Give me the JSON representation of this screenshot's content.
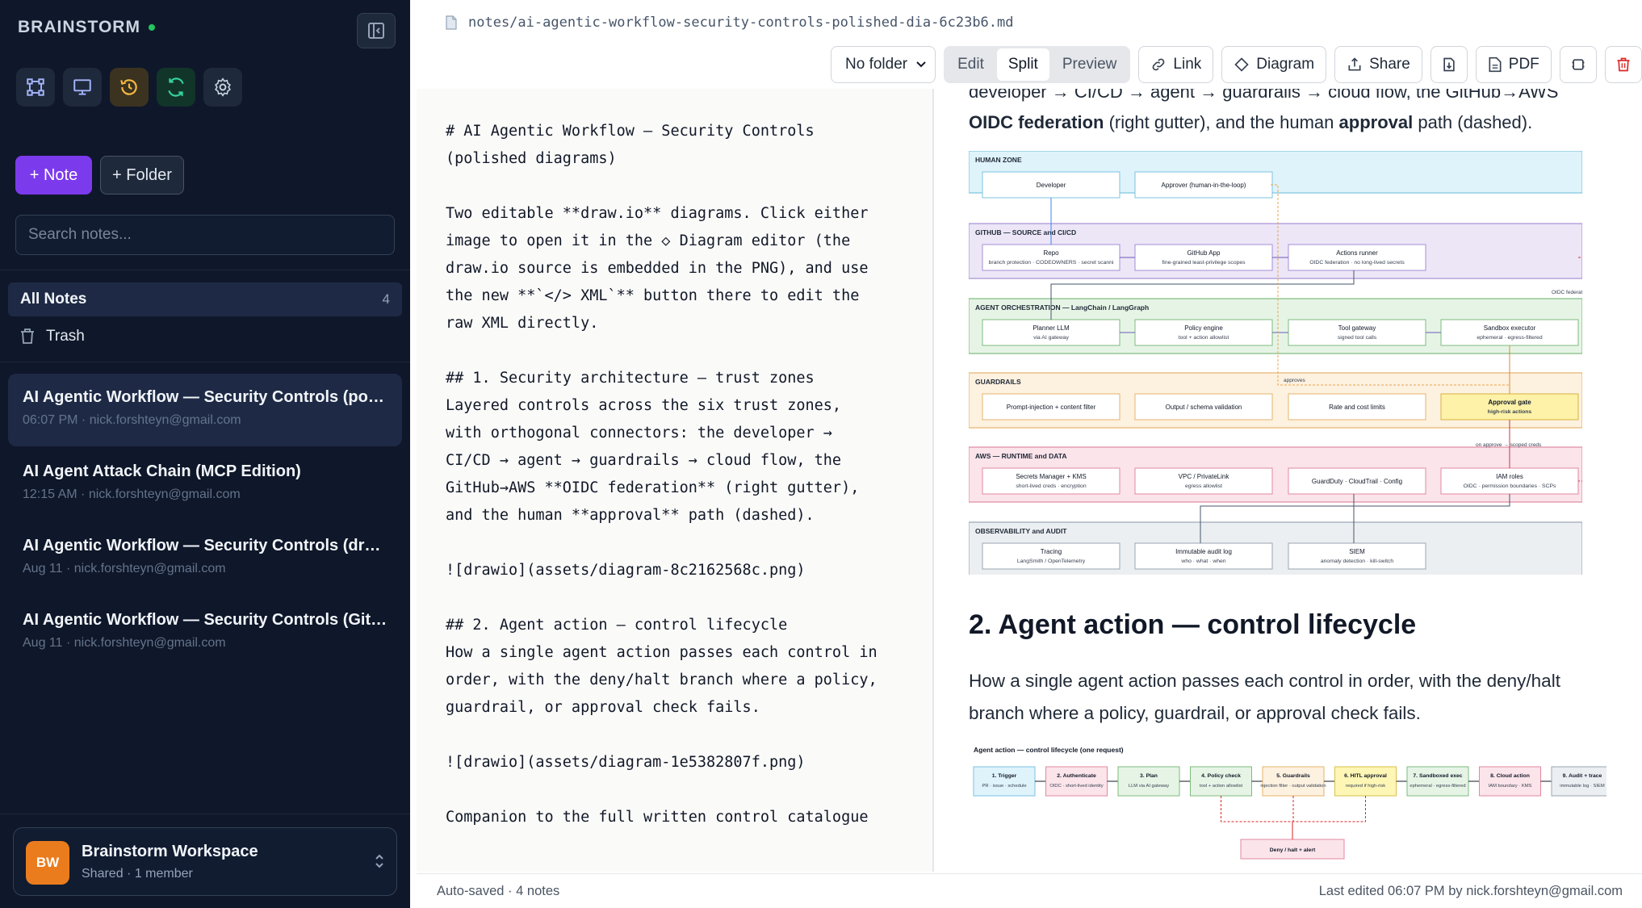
{
  "sidebar": {
    "brand": "BRAINSTORM",
    "new_note_label": "+ Note",
    "new_folder_label": "+ Folder",
    "search_placeholder": "Search notes...",
    "all_notes_label": "All Notes",
    "all_notes_count": "4",
    "trash_label": "Trash",
    "notes": [
      {
        "title": "AI Agentic Workflow — Security Controls (polished diagrams)",
        "meta": "06:07 PM · nick.forshteyn@gmail.com"
      },
      {
        "title": "AI Agent Attack Chain (MCP Edition)",
        "meta": "12:15 AM · nick.forshteyn@gmail.com"
      },
      {
        "title": "AI Agentic Workflow — Security Controls (draw.io)",
        "meta": "Aug 11 · nick.forshteyn@gmail.com"
      },
      {
        "title": "AI Agentic Workflow — Security Controls (GitHub)",
        "meta": "Aug 11 · nick.forshteyn@gmail.com"
      }
    ],
    "workspace": {
      "initials": "BW",
      "name": "Brainstorm Workspace",
      "sub": "Shared · 1 member"
    }
  },
  "header": {
    "file_path": "notes/ai-agentic-workflow-security-controls-polished-dia-6c23b6.md",
    "folder_select": "No folder",
    "modes": [
      "Edit",
      "Split",
      "Preview"
    ],
    "active_mode": "Split",
    "link_label": "Link",
    "diagram_label": "Diagram",
    "share_label": "Share",
    "pdf_label": "PDF"
  },
  "editor": {
    "source": "# AI Agentic Workflow — Security Controls\n(polished diagrams)\n\nTwo editable **draw.io** diagrams. Click either\nimage to open it in the ◇ Diagram editor (the\ndraw.io source is embedded in the PNG), and use\nthe new **`</> XML`** button there to edit the\nraw XML directly.\n\n## 1. Security architecture — trust zones\nLayered controls across the six trust zones,\nwith orthogonal connectors: the developer →\nCI/CD → agent → guardrails → cloud flow, the\nGitHub→AWS **OIDC federation** (right gutter),\nand the human **approval** path (dashed).\n\n![drawio](assets/diagram-8c2162568c.png)\n\n## 2. Agent action — control lifecycle\nHow a single agent action passes each control in\norder, with the deny/halt branch where a policy,\nguardrail, or approval check fails.\n\n![drawio](assets/diagram-1e5382807f.png)\n\nCompanion to the full written control catalogue"
  },
  "preview": {
    "intro_line1": "developer → CI/CD → agent → guardrails → cloud flow, the GitHub→AWS",
    "intro_bold1": "OIDC federation",
    "intro_mid": " (right gutter), and the human ",
    "intro_bold2": "approval",
    "intro_end": " path (dashed).",
    "section2_heading": "2. Agent action — control lifecycle",
    "section2_text": "How a single agent action passes each control in order, with the deny/halt branch where a policy, guardrail, or approval check fails.",
    "diagram1": {
      "zones": [
        {
          "title": "HUMAN ZONE",
          "fill": "#dff3fb",
          "stroke": "#7cc3e0",
          "boxes": [
            [
              "Developer",
              ""
            ],
            [
              "Approver (human-in-the-loop)",
              ""
            ]
          ]
        },
        {
          "title": "GITHUB — SOURCE and CI/CD",
          "fill": "#ece6f7",
          "stroke": "#a58fd6",
          "boxes": [
            [
              "Repo",
              "branch protection · CODEOWNERS · secret scanning · CodeQL"
            ],
            [
              "GitHub App",
              "fine-grained least-privilege scopes"
            ],
            [
              "Actions runner",
              "OIDC federation · no long-lived secrets"
            ]
          ]
        },
        {
          "title": "AGENT ORCHESTRATION — LangChain / LangGraph",
          "fill": "#e6f4e6",
          "stroke": "#7dbb7d",
          "boxes": [
            [
              "Planner LLM",
              "via AI gateway"
            ],
            [
              "Policy engine",
              "tool + action allowlist"
            ],
            [
              "Tool gateway",
              "signed tool calls"
            ],
            [
              "Sandbox executor",
              "ephemeral · egress-filtered"
            ]
          ]
        },
        {
          "title": "GUARDRAILS",
          "fill": "#fdf1e0",
          "stroke": "#e6b46b",
          "boxes": [
            [
              "Prompt-injection + content filter",
              ""
            ],
            [
              "Output / schema validation",
              ""
            ],
            [
              "Rate and cost limits",
              ""
            ],
            [
              "Approval gate",
              "high-risk actions"
            ]
          ]
        },
        {
          "title": "AWS — RUNTIME and DATA",
          "fill": "#fbe4ea",
          "stroke": "#e08aa0",
          "boxes": [
            [
              "Secrets Manager + KMS",
              "short-lived creds · encryption"
            ],
            [
              "VPC / PrivateLink",
              "egress allowlist"
            ],
            [
              "GuardDuty · CloudTrail · Config",
              ""
            ],
            [
              "IAM roles",
              "OIDC · permission boundaries · SCPs"
            ]
          ]
        },
        {
          "title": "OBSERVABILITY and AUDIT",
          "fill": "#eceff2",
          "stroke": "#9aa6b2",
          "boxes": [
            [
              "Tracing",
              "LangSmith / OpenTelemetry"
            ],
            [
              "Immutable audit log",
              "who · what · when"
            ],
            [
              "SIEM",
              "anomaly detection · kill-switch"
            ]
          ]
        }
      ],
      "edge_labels": [
        "approves",
        "on approve → scoped creds",
        "OIDC federation"
      ]
    },
    "diagram2": {
      "title": "Agent action — control lifecycle (one request)",
      "steps": [
        {
          "t": "1. Trigger",
          "s": "PR · issue · schedule",
          "fill": "#dff3fb",
          "stroke": "#7cc3e0"
        },
        {
          "t": "2. Authenticate",
          "s": "OIDC · short-lived identity",
          "fill": "#fbe4ea",
          "stroke": "#e08aa0"
        },
        {
          "t": "3. Plan",
          "s": "LLM via AI gateway",
          "fill": "#e6f4e6",
          "stroke": "#7dbb7d"
        },
        {
          "t": "4. Policy check",
          "s": "tool + action allowlist",
          "fill": "#e6f4e6",
          "stroke": "#7dbb7d"
        },
        {
          "t": "5. Guardrails",
          "s": "injection filter · output validation",
          "fill": "#fdf1e0",
          "stroke": "#e6b46b"
        },
        {
          "t": "6. HITL approval",
          "s": "required if high-risk",
          "fill": "#fdf6b5",
          "stroke": "#d9c24a"
        },
        {
          "t": "7. Sandboxed exec",
          "s": "ephemeral · egress-filtered",
          "fill": "#e6f4e6",
          "stroke": "#7dbb7d"
        },
        {
          "t": "8. Cloud action",
          "s": "IAM boundary · KMS",
          "fill": "#fbe4ea",
          "stroke": "#e08aa0"
        },
        {
          "t": "9. Audit + trace",
          "s": "immutable log · SIEM",
          "fill": "#eceff2",
          "stroke": "#9aa6b2"
        }
      ],
      "deny_label": "Deny / halt + alert"
    }
  },
  "status": {
    "left": "Auto-saved · 4 notes",
    "right": "Last edited 06:07 PM by nick.forshteyn@gmail.com"
  },
  "colors": {
    "sidebar_bg": "#0f172a",
    "accent": "#7c3aed",
    "online_dot": "#22c55e",
    "danger": "#dc2626"
  }
}
